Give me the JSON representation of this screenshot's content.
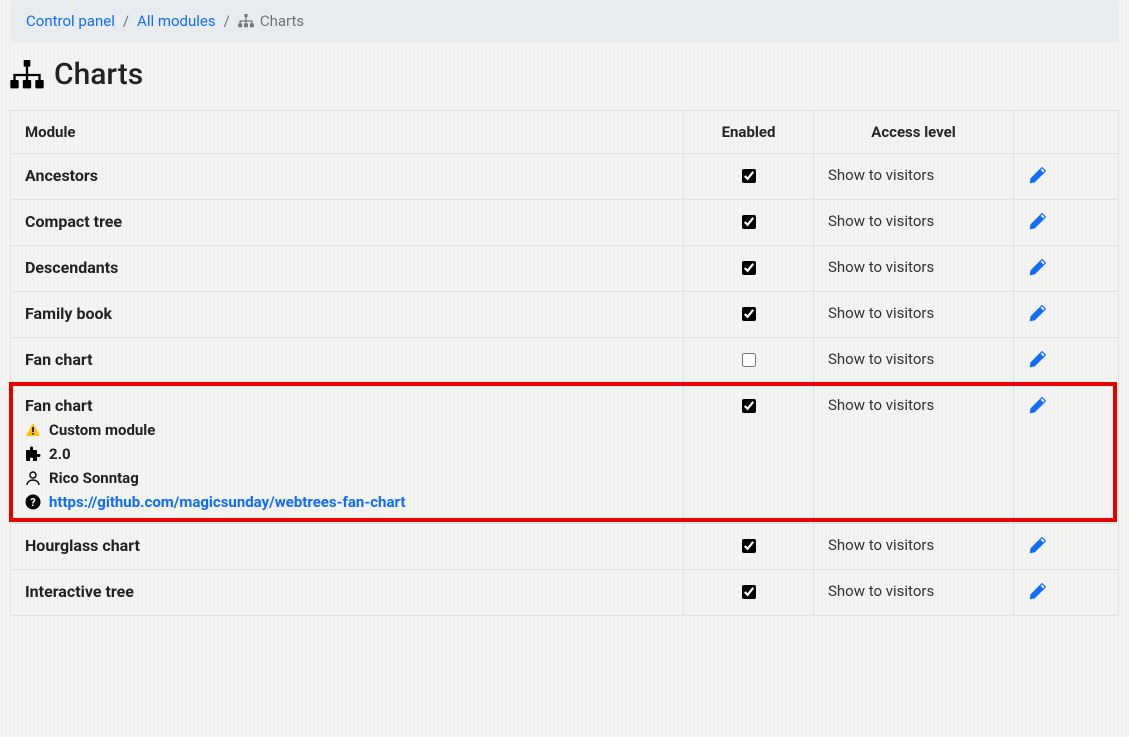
{
  "breadcrumb": {
    "control_panel": "Control panel",
    "all_modules": "All modules",
    "current": "Charts"
  },
  "page": {
    "title": "Charts"
  },
  "table": {
    "headers": {
      "module": "Module",
      "enabled": "Enabled",
      "access": "Access level"
    },
    "rows": [
      {
        "name": "Ancestors",
        "enabled": true,
        "access": "Show to visitors"
      },
      {
        "name": "Compact tree",
        "enabled": true,
        "access": "Show to visitors"
      },
      {
        "name": "Descendants",
        "enabled": true,
        "access": "Show to visitors"
      },
      {
        "name": "Family book",
        "enabled": true,
        "access": "Show to visitors"
      },
      {
        "name": "Fan chart",
        "enabled": false,
        "access": "Show to visitors"
      },
      {
        "name": "Fan chart",
        "enabled": true,
        "access": "Show to visitors",
        "highlight": true,
        "custom": {
          "label": "Custom module",
          "version": "2.0",
          "author": "Rico Sonntag",
          "url": "https://github.com/magicsunday/webtrees-fan-chart"
        }
      },
      {
        "name": "Hourglass chart",
        "enabled": true,
        "access": "Show to visitors"
      },
      {
        "name": "Interactive tree",
        "enabled": true,
        "access": "Show to visitors"
      }
    ]
  }
}
